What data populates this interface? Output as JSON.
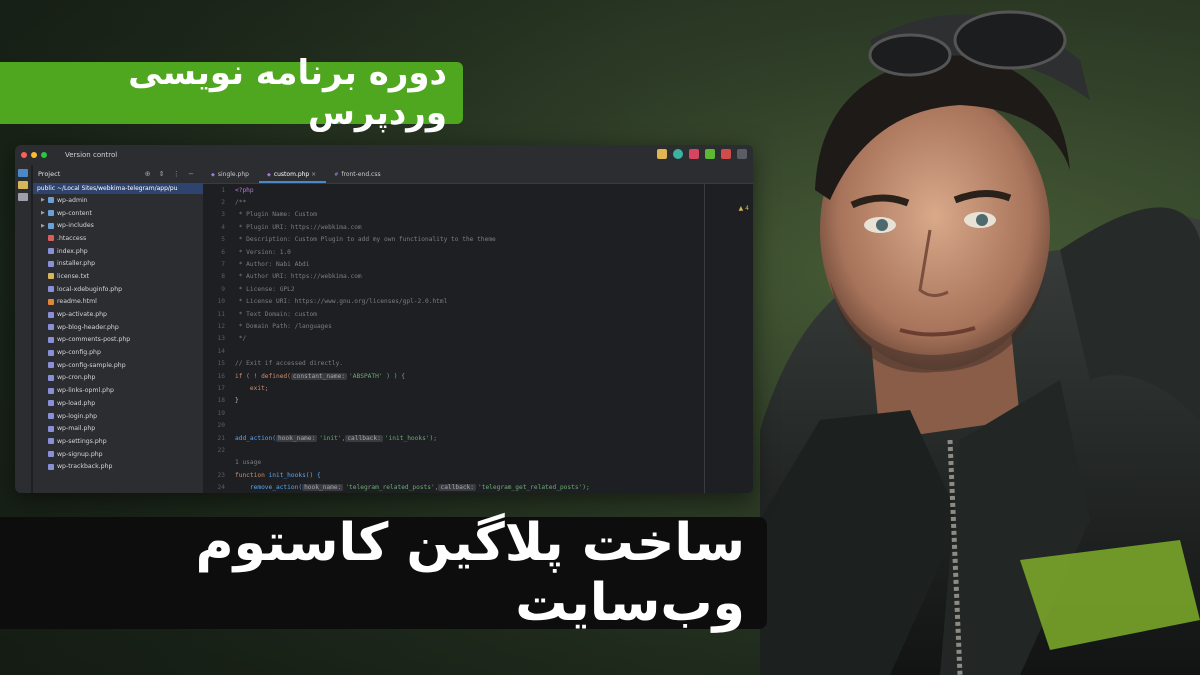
{
  "course_tag": "دوره برنامه نویسی وردپرس",
  "main_title": "ساخت پلاگین کاستوم وب‌سایت",
  "ide": {
    "version_control": "Version control",
    "project_label": "Project",
    "root_label": "public ~/Local Sites/webkima-telegram/app/pu",
    "tree": [
      {
        "name": "wp-admin",
        "type": "folder"
      },
      {
        "name": "wp-content",
        "type": "folder"
      },
      {
        "name": "wp-includes",
        "type": "folder"
      },
      {
        "name": ".htaccess",
        "type": "config"
      },
      {
        "name": "index.php",
        "type": "php"
      },
      {
        "name": "installer.php",
        "type": "php"
      },
      {
        "name": "license.txt",
        "type": "txt"
      },
      {
        "name": "local-xdebuginfo.php",
        "type": "php"
      },
      {
        "name": "readme.html",
        "type": "html"
      },
      {
        "name": "wp-activate.php",
        "type": "php"
      },
      {
        "name": "wp-blog-header.php",
        "type": "php"
      },
      {
        "name": "wp-comments-post.php",
        "type": "php"
      },
      {
        "name": "wp-config.php",
        "type": "php"
      },
      {
        "name": "wp-config-sample.php",
        "type": "php"
      },
      {
        "name": "wp-cron.php",
        "type": "php"
      },
      {
        "name": "wp-links-opml.php",
        "type": "php"
      },
      {
        "name": "wp-load.php",
        "type": "php"
      },
      {
        "name": "wp-login.php",
        "type": "php"
      },
      {
        "name": "wp-mail.php",
        "type": "php"
      },
      {
        "name": "wp-settings.php",
        "type": "php"
      },
      {
        "name": "wp-signup.php",
        "type": "php"
      },
      {
        "name": "wp-trackback.php",
        "type": "php"
      }
    ],
    "tabs": [
      "single.php",
      "custom.php",
      "front-end.css"
    ],
    "active_tab": 1,
    "inspection": "▲ 4",
    "usage_hint": "1 usage",
    "code": {
      "l1": "<?php",
      "l2": "/**",
      "l3": " * Plugin Name: Custom",
      "l4": " * Plugin URI: https://webkima.com",
      "l5": " * Description: Custom Plugin to add my own functionality to the theme",
      "l6": " * Version: 1.0",
      "l7": " * Author: Nabi Abdi",
      "l8": " * Author URI: https://webkima.com",
      "l9": " * License: GPL2",
      "l10": " * License URI: https://www.gnu.org/licenses/gpl-2.0.html",
      "l11": " * Text Domain: custom",
      "l12": " * Domain Path: /languages",
      "l13": " */",
      "l15": "// Exit if accessed directly.",
      "l16a": "if ( ! defined(",
      "l16hint": "constant_name:",
      "l16b": "'ABSPATH' ) ) {",
      "l17": "    exit;",
      "l18": "}",
      "l21a": "add_action(",
      "l21h1": "hook_name:",
      "l21s1": "'init',",
      "l21h2": "callback:",
      "l21s2": "'init_hooks');",
      "l23a": "function",
      "l23b": " init_hooks() {",
      "l24a": "    remove_action(",
      "l24h1": "hook_name:",
      "l24s1": "'telegram_related_posts',",
      "l24h2": "callback:",
      "l24s2": "'telegram_get_related_posts');"
    }
  },
  "colors": {
    "tag_green": "#4fa61f",
    "title_bg": "#0d0d0d",
    "ide_bg": "#1e1f22"
  }
}
